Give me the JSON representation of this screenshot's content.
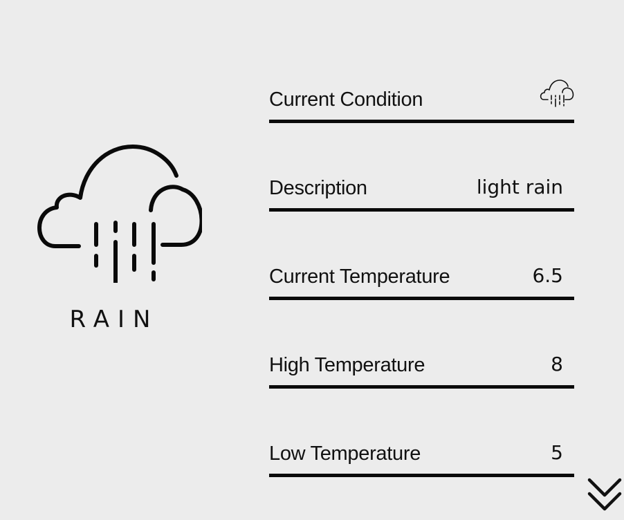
{
  "condition": {
    "title": "RAIN",
    "icon": "rain-cloud-icon"
  },
  "rows": [
    {
      "label": "Current Condition",
      "value": "",
      "icon": "rain-cloud-icon"
    },
    {
      "label": "Description",
      "value": "light rain"
    },
    {
      "label": "Current Temperature",
      "value": "6.5"
    },
    {
      "label": "High Temperature",
      "value": "8"
    },
    {
      "label": "Low Temperature",
      "value": "5"
    }
  ],
  "scroll": {
    "icon": "double-chevron-down-icon"
  }
}
